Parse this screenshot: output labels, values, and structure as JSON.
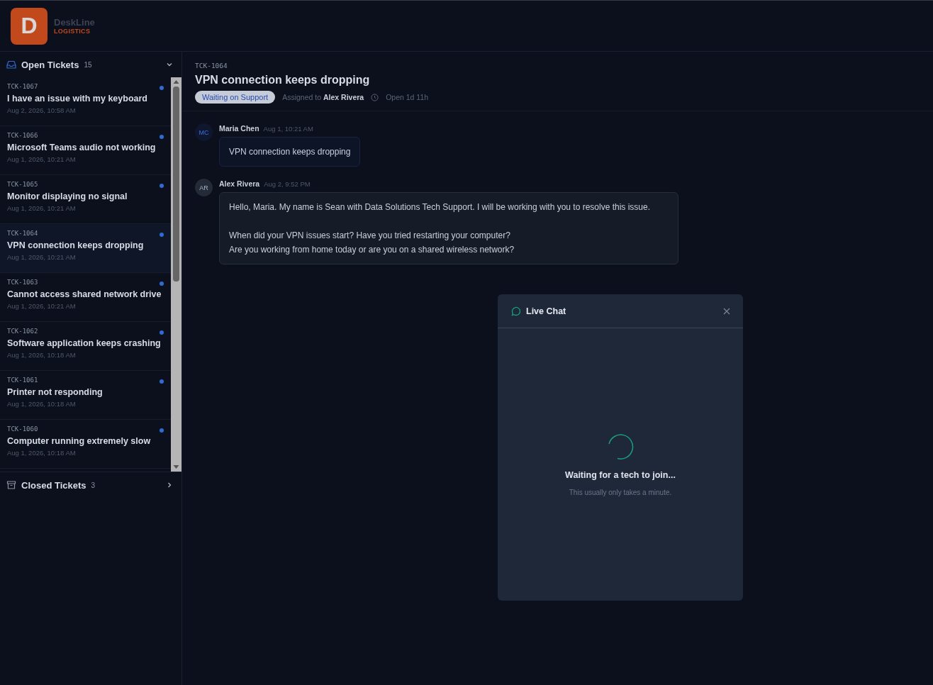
{
  "brand": {
    "letter": "D",
    "name": "DeskLine",
    "tagline": "LOGISTICS"
  },
  "open_tickets": {
    "label": "Open Tickets",
    "count": "15",
    "expanded": true,
    "items": [
      {
        "id": "TCK-1067",
        "title": "I have an issue with my keyboard",
        "date": "Aug 2, 2026, 10:58 AM",
        "unread": true,
        "selected": false
      },
      {
        "id": "TCK-1066",
        "title": "Microsoft Teams audio not working",
        "date": "Aug 1, 2026, 10:21 AM",
        "unread": true,
        "selected": false
      },
      {
        "id": "TCK-1065",
        "title": "Monitor displaying no signal",
        "date": "Aug 1, 2026, 10:21 AM",
        "unread": true,
        "selected": false
      },
      {
        "id": "TCK-1064",
        "title": "VPN connection keeps dropping",
        "date": "Aug 1, 2026, 10:21 AM",
        "unread": true,
        "selected": true
      },
      {
        "id": "TCK-1063",
        "title": "Cannot access shared network drive",
        "date": "Aug 1, 2026, 10:21 AM",
        "unread": true,
        "selected": false
      },
      {
        "id": "TCK-1062",
        "title": "Software application keeps crashing",
        "date": "Aug 1, 2026, 10:18 AM",
        "unread": true,
        "selected": false
      },
      {
        "id": "TCK-1061",
        "title": "Printer not responding",
        "date": "Aug 1, 2026, 10:18 AM",
        "unread": true,
        "selected": false
      },
      {
        "id": "TCK-1060",
        "title": "Computer running extremely slow",
        "date": "Aug 1, 2026, 10:18 AM",
        "unread": true,
        "selected": false
      }
    ]
  },
  "closed_tickets": {
    "label": "Closed Tickets",
    "count": "3",
    "expanded": false
  },
  "ticket": {
    "id": "TCK-1064",
    "title": "VPN connection keeps dropping",
    "status": "Waiting on Support",
    "assigned_label": "Assigned to",
    "assignee": "Alex Rivera",
    "open_time": "Open 1d 11h"
  },
  "messages": [
    {
      "kind": "customer",
      "initials": "MC",
      "author": "Maria Chen",
      "time": "Aug 1, 10:21 AM",
      "paragraphs": [
        "VPN connection keeps dropping"
      ]
    },
    {
      "kind": "agent",
      "initials": "AR",
      "author": "Alex Rivera",
      "time": "Aug 2, 9:52 PM",
      "paragraphs": [
        "Hello, Maria. My name is Sean with Data Solutions Tech Support. I will be working with you to resolve this issue.",
        "When did your VPN issues start? Have you tried restarting your computer?\nAre you working from home today or are you on a shared wireless network?"
      ]
    }
  ],
  "live_chat": {
    "title": "Live Chat",
    "status": "Waiting for a tech to join...",
    "hint": "This usually only takes a minute."
  }
}
